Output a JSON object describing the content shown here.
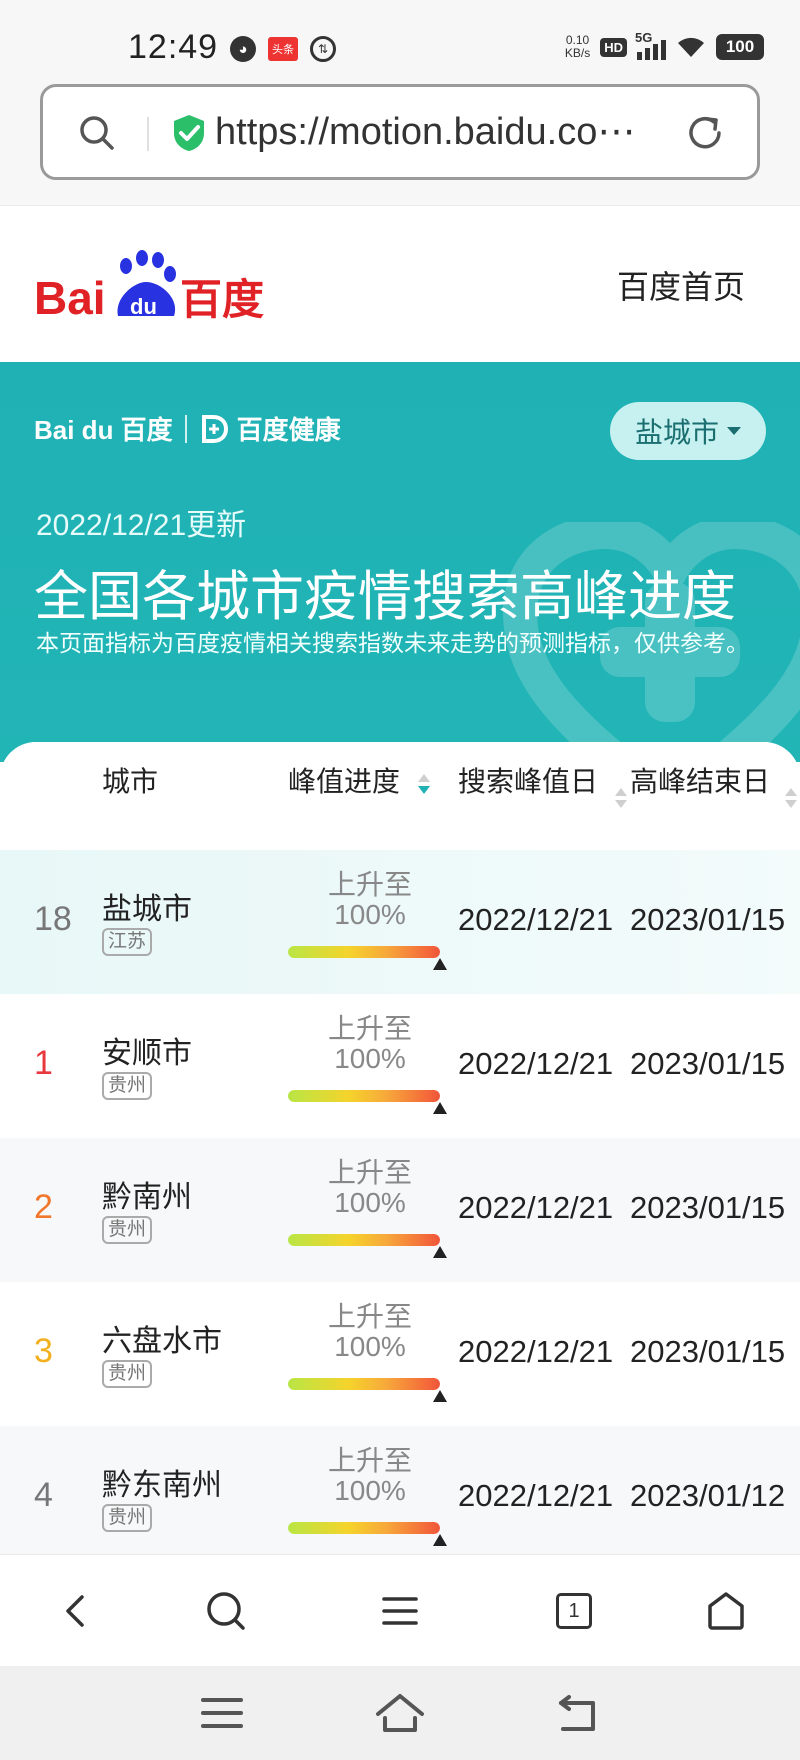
{
  "status_bar": {
    "time": "12:49",
    "news_badge": "头条",
    "net_speed_value": "0.10",
    "net_speed_unit": "KB/s",
    "hd_label": "HD",
    "network_label": "5G",
    "battery": "100"
  },
  "url_bar": {
    "url": "https://motion.baidu.co⋯",
    "secure_color": "#2bbf6a"
  },
  "site_header": {
    "logo_text": "Bai",
    "logo_paw_text": "du",
    "logo_cn": "百度",
    "home_link": "百度首页"
  },
  "banner": {
    "brand_baidu": "Bai du 百度",
    "brand_health": "百度健康",
    "city_selector": "盐城市",
    "update_date": "2022/12/21更新",
    "title": "全国各城市疫情搜索高峰进度",
    "description": "本页面指标为百度疫情相关搜索指数未来走势的预测指标，仅供参考。",
    "accent_color": "#1fb1b4"
  },
  "table": {
    "headers": {
      "city": "城市",
      "progress": "峰值进度",
      "peak_date": "搜索峰值日",
      "end_date": "高峰结束日"
    },
    "rows": [
      {
        "rank": "18",
        "rank_color": "#777777",
        "city": "盐城市",
        "province": "江苏",
        "progress_label": "上升至",
        "progress_value": "100%",
        "progress_fraction": 1.0,
        "peak_date": "2022/12/21",
        "end_date": "2023/01/15"
      },
      {
        "rank": "1",
        "rank_color": "#e8383d",
        "city": "安顺市",
        "province": "贵州",
        "progress_label": "上升至",
        "progress_value": "100%",
        "progress_fraction": 1.0,
        "peak_date": "2022/12/21",
        "end_date": "2023/01/15"
      },
      {
        "rank": "2",
        "rank_color": "#f0772b",
        "city": "黔南州",
        "province": "贵州",
        "progress_label": "上升至",
        "progress_value": "100%",
        "progress_fraction": 1.0,
        "peak_date": "2022/12/21",
        "end_date": "2023/01/15"
      },
      {
        "rank": "3",
        "rank_color": "#f2b01e",
        "city": "六盘水市",
        "province": "贵州",
        "progress_label": "上升至",
        "progress_value": "100%",
        "progress_fraction": 1.0,
        "peak_date": "2022/12/21",
        "end_date": "2023/01/15"
      },
      {
        "rank": "4",
        "rank_color": "#777777",
        "city": "黔东南州",
        "province": "贵州",
        "progress_label": "上升至",
        "progress_value": "100%",
        "progress_fraction": 1.0,
        "peak_date": "2022/12/21",
        "end_date": "2023/01/12"
      }
    ]
  },
  "toolbar": {
    "back_icon": "chevron-left-icon",
    "search_icon": "search-icon",
    "menu_icon": "hamburger-menu-icon",
    "tabs_count": "1",
    "home_icon": "home-icon"
  },
  "system_nav": {
    "menu_icon": "menu-icon",
    "home_icon": "home-icon",
    "back_icon": "back-icon"
  }
}
